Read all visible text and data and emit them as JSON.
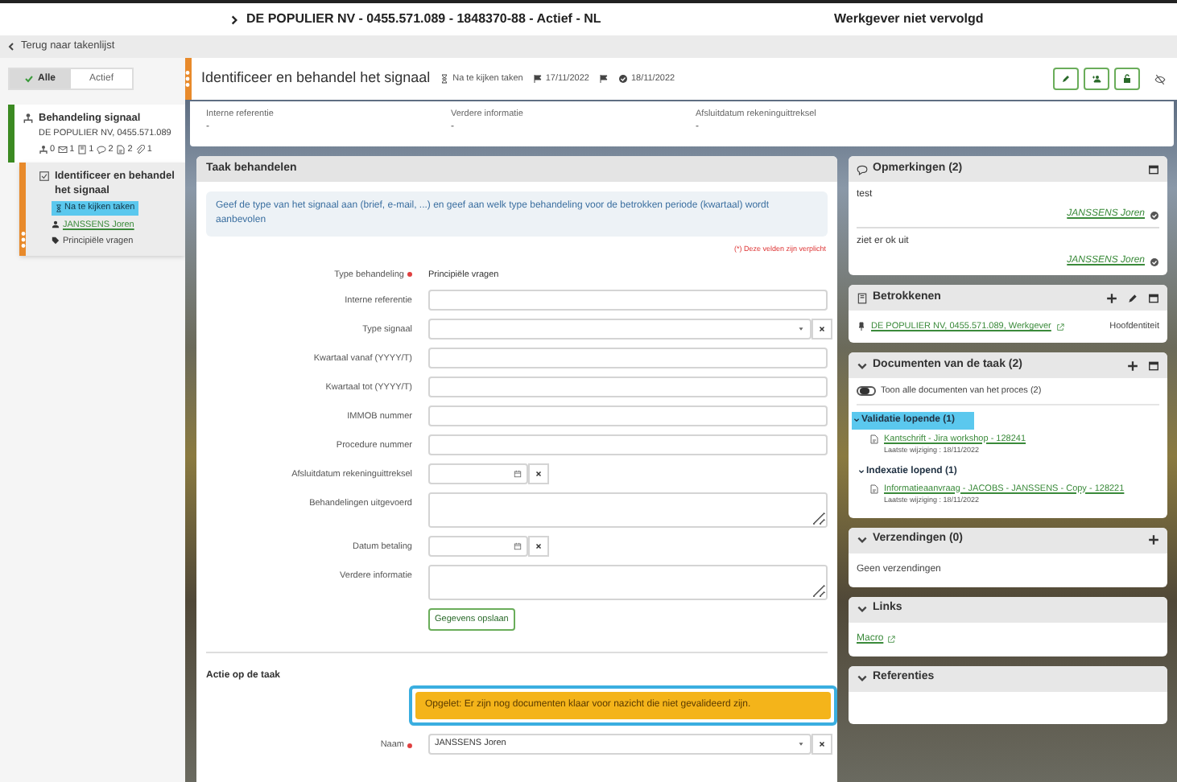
{
  "header": {
    "title": "DE POPULIER NV - 0455.571.089 - 1848370-88 - Actief - NL",
    "status": "Werkgever niet vervolgd"
  },
  "back_link": "Terug naar takenlijst",
  "filter_tabs": [
    {
      "label": "Alle",
      "selected": true
    },
    {
      "label": "Actief",
      "selected": false
    }
  ],
  "process": {
    "title": "Behandeling signaal",
    "subtitle": "DE POPULIER NV, 0455.571.089",
    "counts": [
      "0",
      "1",
      "1",
      "2",
      "2",
      "1"
    ]
  },
  "task_item": {
    "title": "Identificeer en behandel het signaal",
    "status": "Na te kijken taken",
    "assignee": "JANSSENS Joren",
    "category": "Principiële vragen"
  },
  "task": {
    "title": "Identificeer en behandel het signaal",
    "status": "Na te kijken taken",
    "start_date": "17/11/2022",
    "due_date": "18/11/2022"
  },
  "info_fields": [
    {
      "label": "Interne referentie",
      "value": "-"
    },
    {
      "label": "Verdere informatie",
      "value": "-"
    },
    {
      "label": "Afsluitdatum rekeninguittreksel",
      "value": "-"
    }
  ],
  "form": {
    "title": "Taak behandelen",
    "hint": "Geef de type van het signaal aan (brief, e-mail, ...) en geef aan welk type behandeling voor de betrokken periode (kwartaal) wordt aanbevolen",
    "required_note": "(*) Deze velden zijn verplicht",
    "fields": [
      {
        "kind": "static",
        "label": "Type behandeling",
        "required": true,
        "value": "Principiële vragen"
      },
      {
        "kind": "text",
        "label": "Interne referentie",
        "required": false
      },
      {
        "kind": "select",
        "label": "Type signaal",
        "required": false
      },
      {
        "kind": "text",
        "label": "Kwartaal vanaf (YYYY/T)",
        "required": false
      },
      {
        "kind": "text",
        "label": "Kwartaal tot (YYYY/T)",
        "required": false
      },
      {
        "kind": "text",
        "label": "IMMOB nummer",
        "required": false
      },
      {
        "kind": "text",
        "label": "Procedure nummer",
        "required": false
      },
      {
        "kind": "date",
        "label": "Afsluitdatum rekeninguittreksel",
        "required": false
      },
      {
        "kind": "textarea",
        "label": "Behandelingen uitgevoerd",
        "required": false
      },
      {
        "kind": "date",
        "label": "Datum betaling",
        "required": false
      },
      {
        "kind": "textarea",
        "label": "Verdere informatie",
        "required": false
      }
    ],
    "save_button": "Gegevens opslaan"
  },
  "action": {
    "title": "Actie op de taak",
    "warning": "Opgelet: Er zijn nog documenten klaar voor nazicht die niet gevalideerd zijn.",
    "fields": [
      {
        "kind": "select",
        "label": "Naam",
        "required": true,
        "value": "JANSSENS Joren"
      }
    ]
  },
  "comments": {
    "title": "Opmerkingen (2)",
    "items": [
      {
        "text": "test",
        "author": "JANSSENS Joren"
      },
      {
        "text": "ziet er ok uit",
        "author": "JANSSENS Joren"
      }
    ]
  },
  "parties": {
    "title": "Betrokkenen",
    "items": [
      {
        "name": "DE POPULIER NV, 0455.571.089, Werkgever",
        "role": "Hoofdentiteit"
      }
    ]
  },
  "documents": {
    "title": "Documenten van de taak (2)",
    "toggle": {
      "label": "Toon alle documenten van het proces (2)",
      "on": false
    },
    "groups": [
      {
        "title": "Validatie lopende (1)",
        "selected": true,
        "items": [
          {
            "name": "Kantschrift - Jira workshop - 128241",
            "modified": "Laatste wijziging : 18/11/2022"
          }
        ]
      },
      {
        "title": "Indexatie lopend (1)",
        "selected": false,
        "items": [
          {
            "name": "Informatieaanvraag - JACOBS - JANSSENS - Copy - 128221",
            "modified": "Laatste wijziging : 18/11/2022"
          }
        ]
      }
    ]
  },
  "shipments": {
    "title": "Verzendingen (0)",
    "empty": "Geen verzendingen"
  },
  "links": {
    "title": "Links",
    "items": [
      "Macro"
    ]
  },
  "references": {
    "title": "Referenties"
  }
}
